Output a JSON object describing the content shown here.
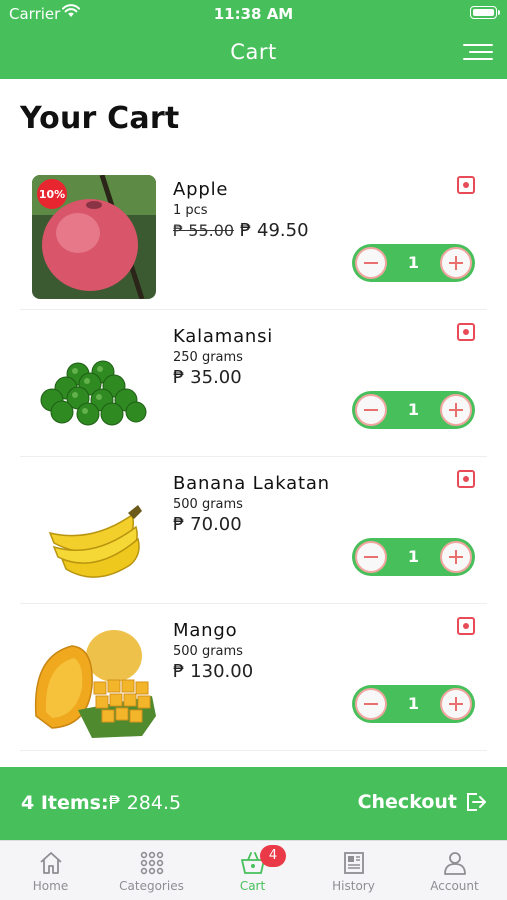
{
  "status_bar": {
    "carrier": "Carrier",
    "time": "11:38 AM"
  },
  "nav": {
    "title": "Cart"
  },
  "page": {
    "title": "Your Cart"
  },
  "items": [
    {
      "name": "Apple",
      "quantity_label": "1 pcs",
      "old_price": "₱ 55.00",
      "price": "₱ 49.50",
      "discount": "10%",
      "count": "1",
      "image_icon": "apple-image"
    },
    {
      "name": "Kalamansi",
      "quantity_label": "250 grams",
      "old_price": "",
      "price": "₱ 35.00",
      "discount": "",
      "count": "1",
      "image_icon": "kalamansi-image"
    },
    {
      "name": "Banana Lakatan",
      "quantity_label": "500 grams",
      "old_price": "",
      "price": "₱ 70.00",
      "discount": "",
      "count": "1",
      "image_icon": "banana-image"
    },
    {
      "name": "Mango",
      "quantity_label": "500 grams",
      "old_price": "",
      "price": "₱ 130.00",
      "discount": "",
      "count": "1",
      "image_icon": "mango-image"
    }
  ],
  "summary": {
    "items_label": "4 Items:",
    "total": "₱ 284.5",
    "checkout_label": "Checkout"
  },
  "tabs": [
    {
      "label": "Home",
      "icon": "home-icon"
    },
    {
      "label": "Categories",
      "icon": "grid-icon"
    },
    {
      "label": "Cart",
      "icon": "basket-icon",
      "badge": "4",
      "active": true
    },
    {
      "label": "History",
      "icon": "newspaper-icon"
    },
    {
      "label": "Account",
      "icon": "user-icon"
    }
  ],
  "colors": {
    "primary": "#47c05b",
    "accent_red": "#e84b57",
    "badge": "#ea3a47",
    "tab_inactive": "#8e8e93"
  }
}
